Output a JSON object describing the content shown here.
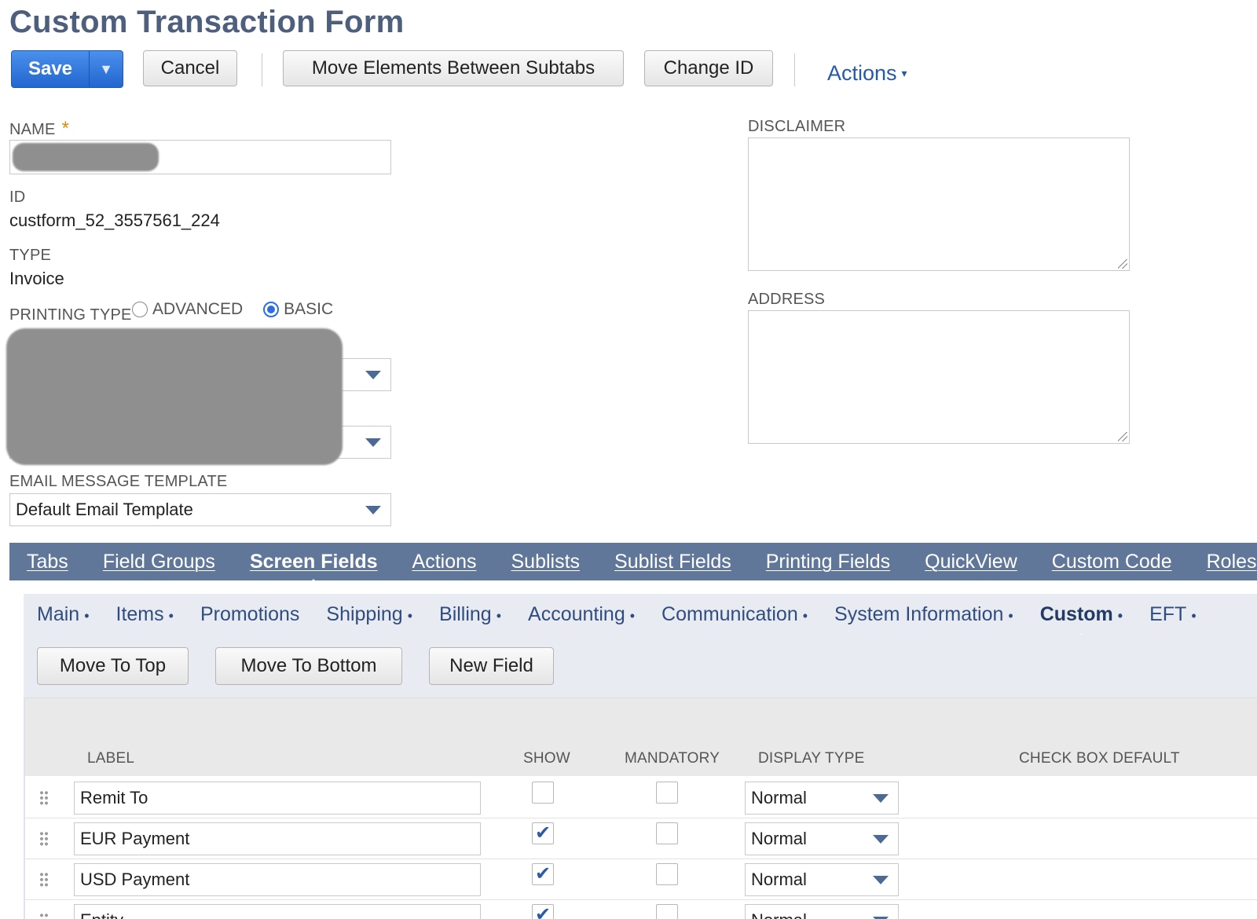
{
  "page": {
    "title": "Custom Transaction Form"
  },
  "toolbar": {
    "save_label": "Save",
    "save_arrow": "▼",
    "cancel_label": "Cancel",
    "move_elements_label": "Move Elements Between Subtabs",
    "change_id_label": "Change ID",
    "actions_label": "Actions",
    "actions_caret": "▾"
  },
  "form": {
    "name_label": "NAME",
    "required_mark": "*",
    "id_label": "ID",
    "id_value": "custform_52_3557561_224",
    "type_label": "TYPE",
    "type_value": "Invoice",
    "printing_type_label": "PRINTING TYPE",
    "printing_options": [
      "ADVANCED",
      "BASIC"
    ],
    "printing_selected": "BASIC",
    "email_template_label": "EMAIL MESSAGE TEMPLATE",
    "email_template_value": "Default Email Template",
    "disclaimer_label": "DISCLAIMER",
    "address_label": "ADDRESS"
  },
  "main_tabs": [
    "Tabs",
    "Field Groups",
    "Screen Fields",
    "Actions",
    "Sublists",
    "Sublist Fields",
    "Printing Fields",
    "QuickView",
    "Custom Code",
    "Roles"
  ],
  "main_tab_active": "Screen Fields",
  "subtabs": [
    {
      "label": "Main",
      "dot": "•"
    },
    {
      "label": "Items",
      "dot": "•"
    },
    {
      "label": "Promotions",
      "dot": ""
    },
    {
      "label": "Shipping",
      "dot": "•"
    },
    {
      "label": "Billing",
      "dot": "•"
    },
    {
      "label": "Accounting",
      "dot": "•"
    },
    {
      "label": "Communication",
      "dot": "•"
    },
    {
      "label": "System Information",
      "dot": "•"
    },
    {
      "label": "Custom",
      "dot": "•"
    },
    {
      "label": "EFT",
      "dot": "•"
    }
  ],
  "subtab_active": "Custom",
  "field_toolbar": {
    "move_top": "Move To Top",
    "move_bottom": "Move To Bottom",
    "new_field": "New Field"
  },
  "grid": {
    "headers": {
      "label": "LABEL",
      "show": "SHOW",
      "mandatory": "MANDATORY",
      "display_type": "DISPLAY TYPE",
      "check_box_default": "CHECK BOX DEFAULT"
    },
    "check_mark": "✔",
    "rows": [
      {
        "label": "Remit To",
        "show": false,
        "mandatory": false,
        "display_type": "Normal"
      },
      {
        "label": "EUR Payment",
        "show": true,
        "mandatory": false,
        "display_type": "Normal"
      },
      {
        "label": "USD Payment",
        "show": true,
        "mandatory": false,
        "display_type": "Normal"
      },
      {
        "label": "Entity",
        "show": true,
        "mandatory": false,
        "display_type": "Normal"
      }
    ]
  }
}
